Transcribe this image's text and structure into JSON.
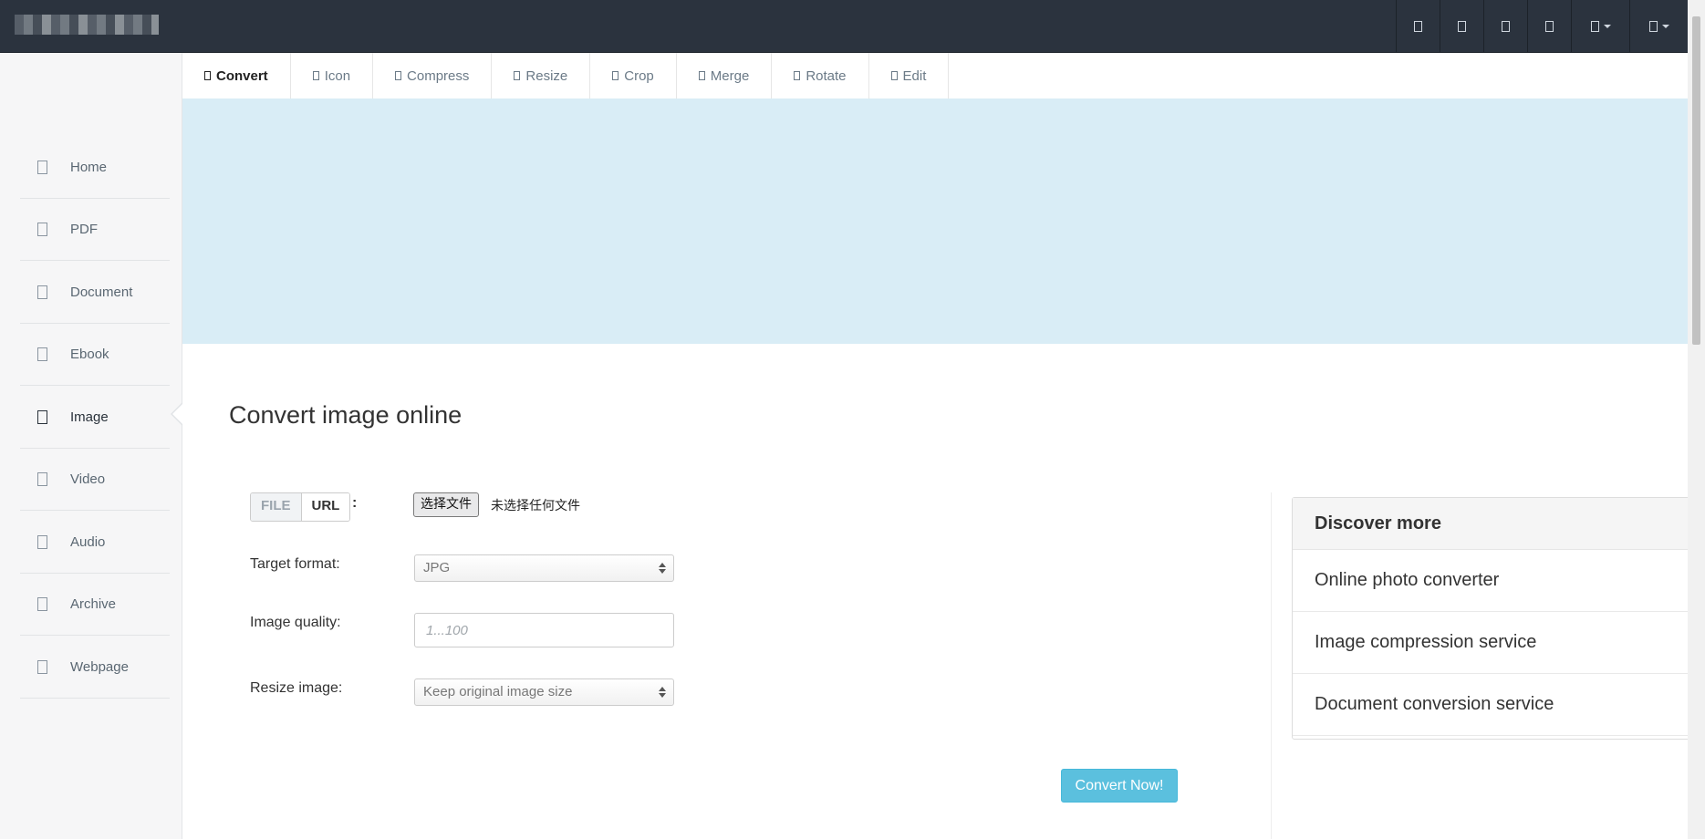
{
  "topbar": {
    "icons": [
      "nav-icon-1",
      "nav-icon-2",
      "nav-icon-3",
      "nav-icon-4"
    ],
    "dropdowns": [
      "nav-dropdown-1",
      "nav-dropdown-2"
    ]
  },
  "sidebar": {
    "items": [
      {
        "label": "Home"
      },
      {
        "label": "PDF"
      },
      {
        "label": "Document"
      },
      {
        "label": "Ebook"
      },
      {
        "label": "Image",
        "active": true
      },
      {
        "label": "Video"
      },
      {
        "label": "Audio"
      },
      {
        "label": "Archive"
      },
      {
        "label": "Webpage"
      }
    ]
  },
  "tabs": [
    {
      "label": "Convert",
      "active": true
    },
    {
      "label": "Icon"
    },
    {
      "label": "Compress"
    },
    {
      "label": "Resize"
    },
    {
      "label": "Crop"
    },
    {
      "label": "Merge"
    },
    {
      "label": "Rotate"
    },
    {
      "label": "Edit"
    }
  ],
  "main": {
    "title": "Convert image online",
    "source_toggle": {
      "file": "FILE",
      "url": "URL",
      "colon": ":"
    },
    "file_input": {
      "button": "选择文件",
      "status": "未选择任何文件"
    },
    "target_format": {
      "label": "Target format:",
      "value": "JPG"
    },
    "image_quality": {
      "label": "Image quality:",
      "placeholder": "1...100"
    },
    "resize_image": {
      "label": "Resize image:",
      "value": "Keep original image size"
    },
    "convert_button": "Convert Now!"
  },
  "discover": {
    "heading": "Discover more",
    "items": [
      "Online photo converter",
      "Image compression service",
      "Document conversion service"
    ]
  },
  "colors": {
    "topbar": "#2b333e",
    "banner": "#d9edf6",
    "button": "#5bc0de"
  }
}
